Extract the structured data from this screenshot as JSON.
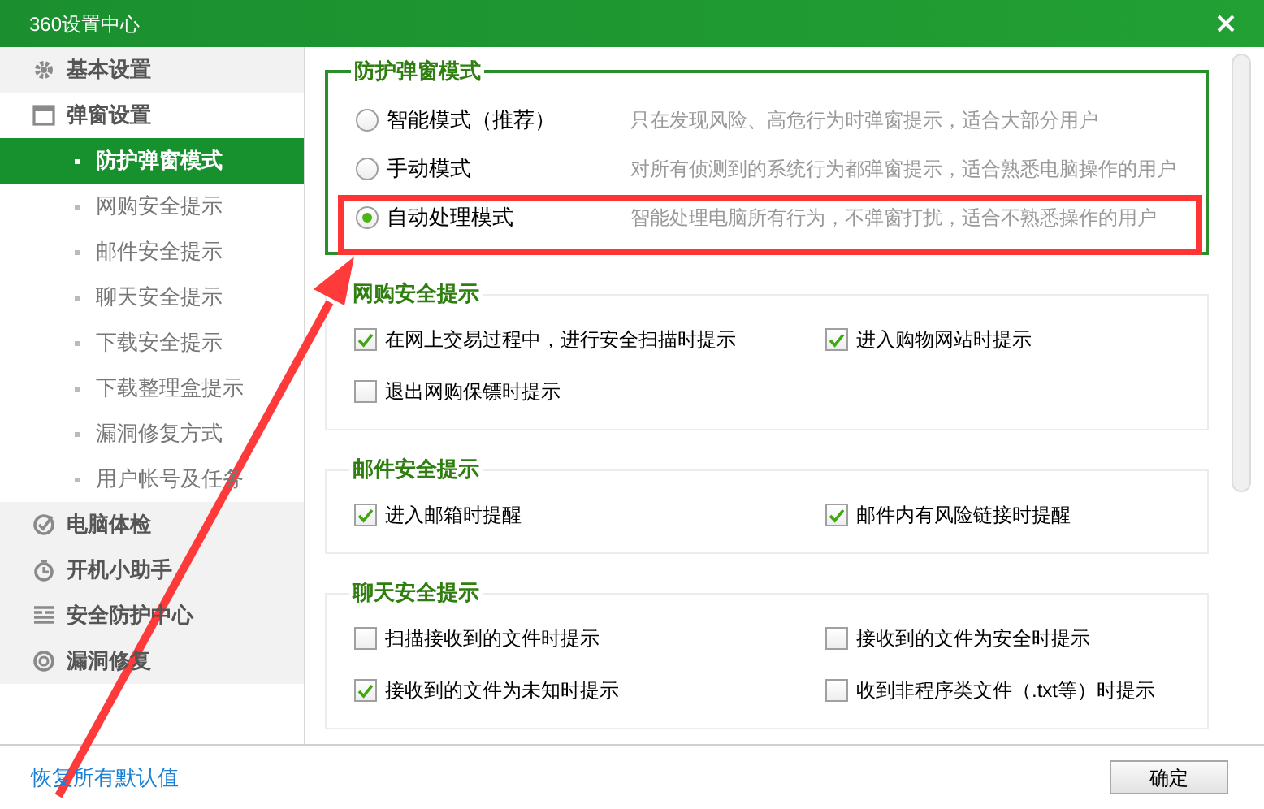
{
  "window": {
    "title": "360设置中心"
  },
  "sidebar": {
    "items": [
      {
        "label": "基本设置",
        "kind": "gear",
        "expanded": false
      },
      {
        "label": "弹窗设置",
        "kind": "window",
        "expanded": true,
        "children": [
          {
            "label": "防护弹窗模式",
            "selected": true
          },
          {
            "label": "网购安全提示",
            "selected": false
          },
          {
            "label": "邮件安全提示",
            "selected": false
          },
          {
            "label": "聊天安全提示",
            "selected": false
          },
          {
            "label": "下载安全提示",
            "selected": false
          },
          {
            "label": "下载整理盒提示",
            "selected": false
          },
          {
            "label": "漏洞修复方式",
            "selected": false
          },
          {
            "label": "用户帐号及任务",
            "selected": false
          }
        ]
      },
      {
        "label": "电脑体检",
        "kind": "check",
        "expanded": false
      },
      {
        "label": "开机小助手",
        "kind": "timer",
        "expanded": false
      },
      {
        "label": "安全防护中心",
        "kind": "bars",
        "expanded": false
      },
      {
        "label": "漏洞修复",
        "kind": "ring",
        "expanded": false
      }
    ]
  },
  "sections": [
    {
      "title": "防护弹窗模式",
      "kind": "radio",
      "options": [
        {
          "label": "智能模式（推荐）",
          "description": "只在发现风险、高危行为时弹窗提示，适合大部分用户",
          "selected": false
        },
        {
          "label": "手动模式",
          "description": "对所有侦测到的系统行为都弹窗提示，适合熟悉电脑操作的用户",
          "selected": false
        },
        {
          "label": "自动处理模式",
          "description": "智能处理电脑所有行为，不弹窗打扰，适合不熟悉操作的用户",
          "selected": true
        }
      ]
    },
    {
      "title": "网购安全提示",
      "kind": "checkbox",
      "options": [
        {
          "label": "在网上交易过程中，进行安全扫描时提示",
          "checked": true
        },
        {
          "label": "进入购物网站时提示",
          "checked": true
        },
        {
          "label": "退出网购保镖时提示",
          "checked": false
        }
      ]
    },
    {
      "title": "邮件安全提示",
      "kind": "checkbox",
      "options": [
        {
          "label": "进入邮箱时提醒",
          "checked": true
        },
        {
          "label": "邮件内有风险链接时提醒",
          "checked": true
        }
      ]
    },
    {
      "title": "聊天安全提示",
      "kind": "checkbox",
      "options": [
        {
          "label": "扫描接收到的文件时提示",
          "checked": false
        },
        {
          "label": "接收到的文件为安全时提示",
          "checked": false
        },
        {
          "label": "接收到的文件为未知时提示",
          "checked": true
        },
        {
          "label": "收到非程序类文件（.txt等）时提示",
          "checked": false
        }
      ]
    }
  ],
  "footer": {
    "link": "恢复所有默认值",
    "button": "确定"
  }
}
